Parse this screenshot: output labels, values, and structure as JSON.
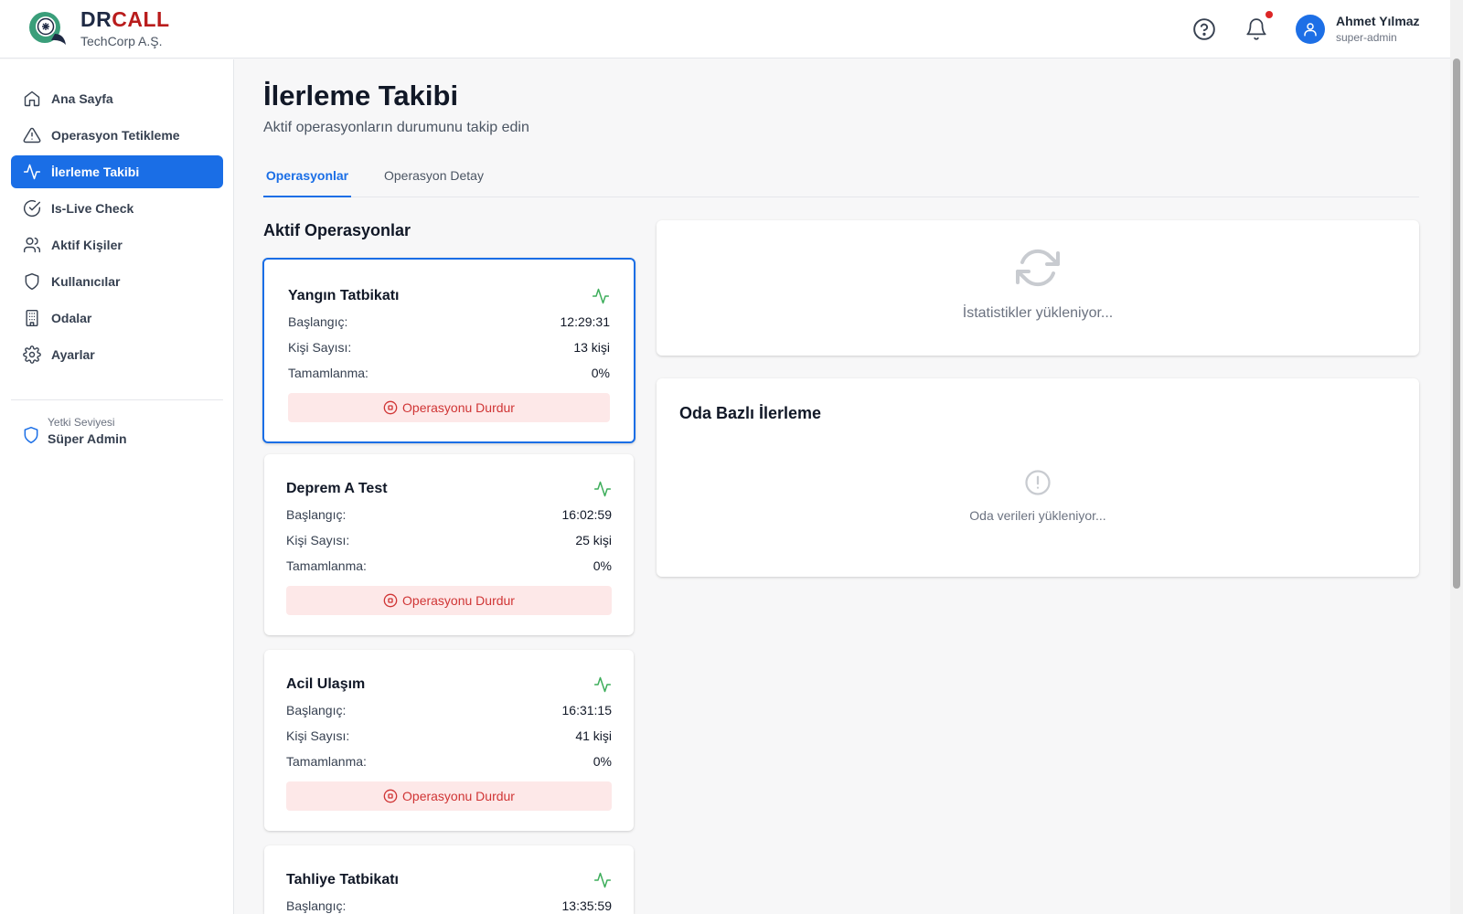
{
  "brand": {
    "name_part1": "DR",
    "name_part2": "CALL",
    "company": "TechCorp A.Ş."
  },
  "header": {
    "user_name": "Ahmet Yılmaz",
    "user_role": "super-admin",
    "has_notification": true
  },
  "sidebar": {
    "items": [
      {
        "label": "Ana Sayfa",
        "icon": "home-icon"
      },
      {
        "label": "Operasyon Tetikleme",
        "icon": "alert-triangle-icon"
      },
      {
        "label": "İlerleme Takibi",
        "icon": "activity-icon",
        "active": true
      },
      {
        "label": "Is-Live Check",
        "icon": "check-circle-icon"
      },
      {
        "label": "Aktif Kişiler",
        "icon": "users-icon"
      },
      {
        "label": "Kullanıcılar",
        "icon": "shield-icon"
      },
      {
        "label": "Odalar",
        "icon": "building-icon"
      },
      {
        "label": "Ayarlar",
        "icon": "gear-icon"
      }
    ],
    "permission_label": "Yetki Seviyesi",
    "permission_value": "Süper Admin"
  },
  "page": {
    "title": "İlerleme Takibi",
    "subtitle": "Aktif operasyonların durumunu takip edin"
  },
  "tabs": [
    {
      "label": "Operasyonlar",
      "active": true
    },
    {
      "label": "Operasyon Detay"
    }
  ],
  "operations": {
    "title": "Aktif Operasyonlar",
    "labels": {
      "start": "Başlangıç:",
      "people": "Kişi Sayısı:",
      "completion": "Tamamlanma:",
      "stop": "Operasyonu Durdur"
    },
    "items": [
      {
        "name": "Yangın Tatbikatı",
        "start": "12:29:31",
        "people": "13 kişi",
        "completion": "0%"
      },
      {
        "name": "Deprem A Test",
        "start": "16:02:59",
        "people": "25 kişi",
        "completion": "0%"
      },
      {
        "name": "Acil Ulaşım",
        "start": "16:31:15",
        "people": "41 kişi",
        "completion": "0%"
      },
      {
        "name": "Tahliye Tatbikatı",
        "start": "13:35:59"
      }
    ]
  },
  "stats": {
    "loading_text": "İstatistikler yükleniyor..."
  },
  "rooms": {
    "title": "Oda Bazlı İlerleme",
    "loading_text": "Oda verileri yükleniyor..."
  },
  "colors": {
    "primary": "#1a6ee6",
    "danger": "#d03535",
    "danger_bg": "#fde8e8",
    "pulse": "#3fae5c",
    "brand_red": "#b91c1c",
    "brand_navy": "#1f2a44"
  }
}
